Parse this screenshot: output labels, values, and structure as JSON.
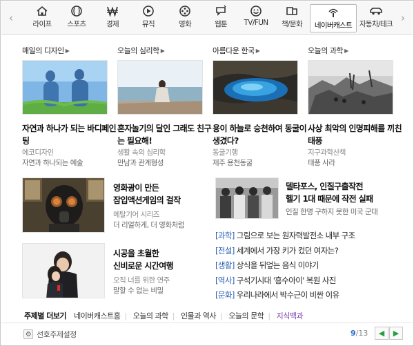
{
  "nav": {
    "categories": [
      {
        "label": "라이프",
        "icon": "house-icon"
      },
      {
        "label": "스포츠",
        "icon": "ball-icon"
      },
      {
        "label": "경제",
        "icon": "won-icon"
      },
      {
        "label": "뮤직",
        "icon": "play-icon"
      },
      {
        "label": "영화",
        "icon": "film-reel-icon"
      },
      {
        "label": "웹툰",
        "icon": "speech-bubble-icon"
      },
      {
        "label": "TV/FUN",
        "icon": "smile-icon"
      },
      {
        "label": "책/문화",
        "icon": "book-icon"
      },
      {
        "label": "네이버캐스트",
        "icon": "broadcast-icon",
        "active": true
      },
      {
        "label": "자동차/테크",
        "icon": "car-icon"
      }
    ]
  },
  "sections": [
    {
      "heading": "매일의 디자인",
      "title": "자연과 하나가 되는 바디페인팅",
      "source": "에코디자인",
      "subtitle": "자연과 하나되는 예술"
    },
    {
      "heading": "오늘의 심리학",
      "title": "혼자놀기의 달인 그래도 친구는 필요해!",
      "source": "생활 속의 심리학",
      "subtitle": "만남과 관계형성"
    },
    {
      "heading": "아름다운 한국",
      "title": "용이 하늘로 승천하여 동굴이 생겼다?",
      "source": "동굴기행",
      "subtitle": "제주 용천동굴"
    },
    {
      "heading": "오늘의 과학",
      "title": "사상 최악의 인명피해를 끼친 태풍",
      "source": "지구과학산책",
      "subtitle": "태풍 사라"
    }
  ],
  "features": [
    {
      "title_line1": "영화광이 만든",
      "title_line2": "잠입액션게임의 걸작",
      "source": "메탈기어 시리즈",
      "subtitle": "더 리얼하게, 더 영화처럼"
    },
    {
      "title_line1": "델타포스, 인질구출작전",
      "title_line2": "헬기 1대 때문에 작전 실패",
      "source": "",
      "subtitle": "인질 한명 구하지 못한 미국 군대"
    },
    {
      "title_line1": "시공을 초월한",
      "title_line2": "신비로운 시간여행",
      "source": "오직 너를 위한 연주",
      "subtitle": "말할 수 없는 비밀"
    }
  ],
  "news": [
    {
      "tag": "[과학]",
      "text": "그림으로 보는 원자력발전소 내부 구조"
    },
    {
      "tag": "[전설]",
      "text": "세계에서 가장 키가 컸던 여자는?"
    },
    {
      "tag": "[생활]",
      "text": "상식을 뒤엎는 음식 이야기"
    },
    {
      "tag": "[역사]",
      "text": "구석기시대 '흥수아이' 복원 사진"
    },
    {
      "tag": "[문화]",
      "text": "우리나라에서 박수근이 비싼 이유"
    }
  ],
  "topics": {
    "label": "주제별 더보기",
    "items": [
      "네이버캐스트홈",
      "오늘의 과학",
      "인물과 역사",
      "오늘의 문학",
      "지식백과"
    ]
  },
  "footer": {
    "pref_label": "선호주제설정",
    "page_current": "9",
    "page_sep": "/",
    "page_total": "13"
  },
  "colors": {
    "tag_blue": "#2b5fb3",
    "page_blue": "#2b6fd1",
    "accent_purple": "#7a3fb0",
    "arrow_green": "#2a9d3f"
  }
}
